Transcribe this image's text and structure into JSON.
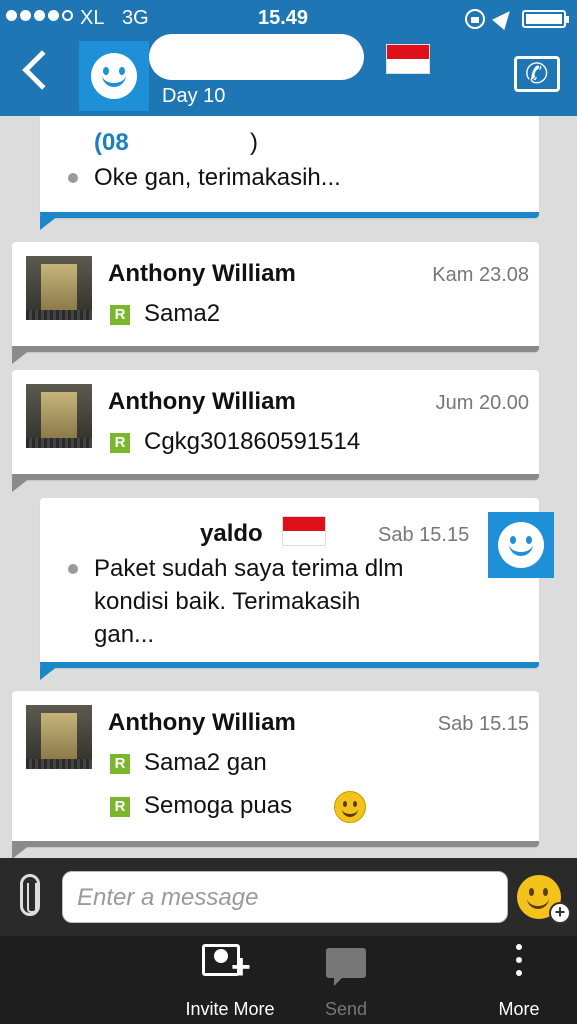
{
  "status_bar": {
    "carrier": "XL",
    "network": "3G",
    "time": "15.49"
  },
  "header": {
    "subtitle": "Day 10",
    "back_icon": "chevron-left-icon",
    "call_icon": "phone-icon",
    "flag_colors": [
      "#e0101b",
      "#ffffff"
    ]
  },
  "messages": [
    {
      "direction": "outgoing",
      "lines": [
        "(08",
        ")",
        "Oke gan, terimakasih..."
      ]
    },
    {
      "direction": "incoming",
      "sender": "Anthony William",
      "time": "Kam 23.08",
      "lines": [
        "Sama2"
      ]
    },
    {
      "direction": "incoming",
      "sender": "Anthony William",
      "time": "Jum 20.00",
      "lines": [
        "Cgkg301860591514"
      ]
    },
    {
      "direction": "outgoing",
      "sender": "yaldo",
      "time": "Sab 15.15",
      "lines": [
        "Paket sudah saya terima dlm",
        "kondisi baik. Terimakasih",
        "gan..."
      ]
    },
    {
      "direction": "incoming",
      "sender": "Anthony William",
      "time": "Sab 15.15",
      "lines": [
        "Sama2 gan",
        "Semoga puas"
      ]
    }
  ],
  "read_badge": "R",
  "composer": {
    "placeholder": "Enter a message"
  },
  "toolbar": {
    "invite_label": "Invite More",
    "send_label": "Send",
    "more_label": "More"
  },
  "colors": {
    "header": "#1f76b4",
    "outgoing_accent": "#1b86c8",
    "read_badge": "#7ab72e"
  }
}
